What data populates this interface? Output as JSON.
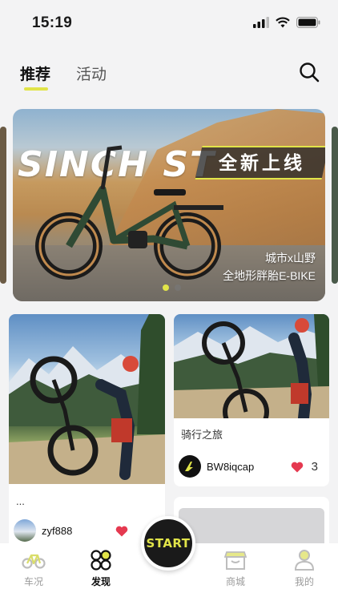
{
  "status_bar": {
    "time": "15:19"
  },
  "tabs": [
    {
      "label": "推荐",
      "active": true
    },
    {
      "label": "活动",
      "active": false
    }
  ],
  "banner": {
    "brand": "SINCH ST",
    "slogan": "全新上线",
    "caption_line1": "城市x山野",
    "caption_line2": "全地形胖胎E-BIKE",
    "page_count": 2,
    "active_page": 1
  },
  "posts": [
    {
      "title": "...",
      "author": "zyf888",
      "likes": ""
    },
    {
      "title": "骑行之旅",
      "author": "BW8iqcap",
      "likes": "3"
    }
  ],
  "start_button": {
    "label": "START"
  },
  "bottom_nav": [
    {
      "label": "车况",
      "icon": "bike-icon",
      "active": false
    },
    {
      "label": "发现",
      "icon": "discover-icon",
      "active": true
    },
    {
      "label": "商城",
      "icon": "store-icon",
      "active": false
    },
    {
      "label": "我的",
      "icon": "profile-icon",
      "active": false
    }
  ],
  "colors": {
    "accent": "#e1e449",
    "like": "#e53950",
    "background": "#f3f3f4"
  }
}
